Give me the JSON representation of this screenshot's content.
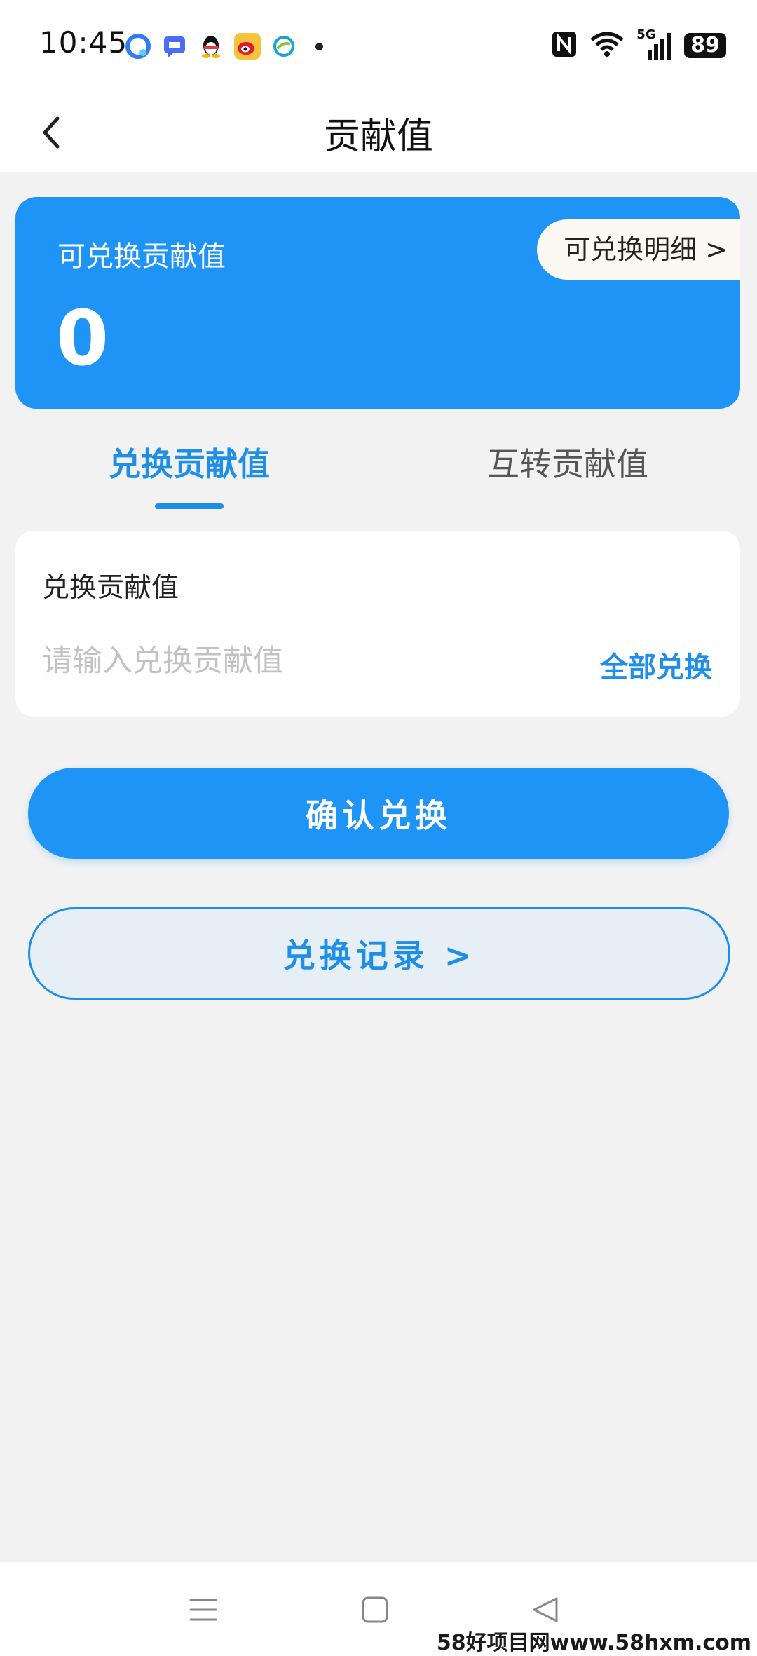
{
  "status_bar": {
    "time": "10:45",
    "network": "5G",
    "battery": "89"
  },
  "header": {
    "title": "贡献值"
  },
  "balance_card": {
    "label": "可兑换贡献值",
    "value": "0",
    "detail_link": "可兑换明细 >"
  },
  "tabs": [
    {
      "label": "兑换贡献值",
      "active": true
    },
    {
      "label": "互转贡献值",
      "active": false
    }
  ],
  "exchange_form": {
    "label": "兑换贡献值",
    "placeholder": "请输入兑换贡献值",
    "all_button": "全部兑换"
  },
  "actions": {
    "confirm": "确认兑换",
    "records": "兑换记录 >"
  },
  "watermark": "58好项目网www.58hxm.com",
  "colors": {
    "accent": "#1e94f6",
    "accent_text": "#1e8fe9",
    "background": "#f2f2f3"
  }
}
